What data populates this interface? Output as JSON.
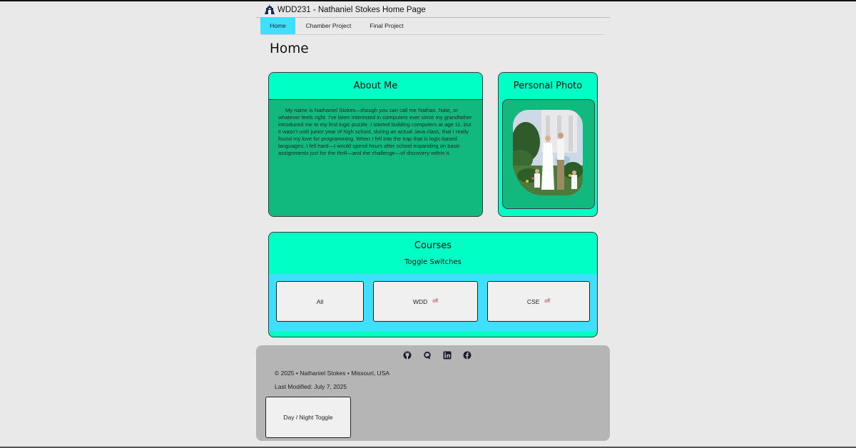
{
  "header": {
    "site_title": "WDD231 - Nathaniel Stokes Home Page",
    "logo_icon": "temple-logo-icon"
  },
  "nav": {
    "items": [
      {
        "label": "Home",
        "active": true
      },
      {
        "label": "Chamber Project",
        "active": false
      },
      {
        "label": "Final Project",
        "active": false
      }
    ]
  },
  "main": {
    "page_title": "Home",
    "about": {
      "title": "About Me",
      "text": "My name is Nathaniel Stokes—though you can call me Nathan, Nate, or whatever feels right. I've been interested in computers ever since my grandfather introduced me to my first logic puzzle. I started building computers at age 11, but it wasn't until junior year of high school, during an actual Java class, that I really found my love for programming. When I fell into the trap that is logic-based languages, I fell hard—I would spend hours after school expanding on basic assignments just for the thrill—and the challenge—of discovery within it."
    },
    "photo": {
      "title": "Personal Photo"
    },
    "courses": {
      "title": "Courses",
      "subtitle": "Toggle Switches",
      "buttons": [
        {
          "label": "All",
          "state": ""
        },
        {
          "label": "WDD",
          "state": "off"
        },
        {
          "label": "CSE",
          "state": "off"
        }
      ]
    }
  },
  "footer": {
    "social_icons": [
      "github-icon",
      "quora-icon",
      "linkedin-icon",
      "facebook-icon"
    ],
    "copyright": "© 2025 • Nathaniel Stokes • Missouri, USA",
    "last_modified": "Last Modified: July 7, 2025",
    "theme_toggle_label": "Day / Night Toggle"
  },
  "colors": {
    "page_bg": "#e9e9e9",
    "card_accent": "#00ffc4",
    "card_body": "#12b97f",
    "nav_active": "#3fe0ff",
    "toggle_panel": "#3fe0ff",
    "footer_bg": "#b5b5b5",
    "off_text": "#b83232"
  }
}
